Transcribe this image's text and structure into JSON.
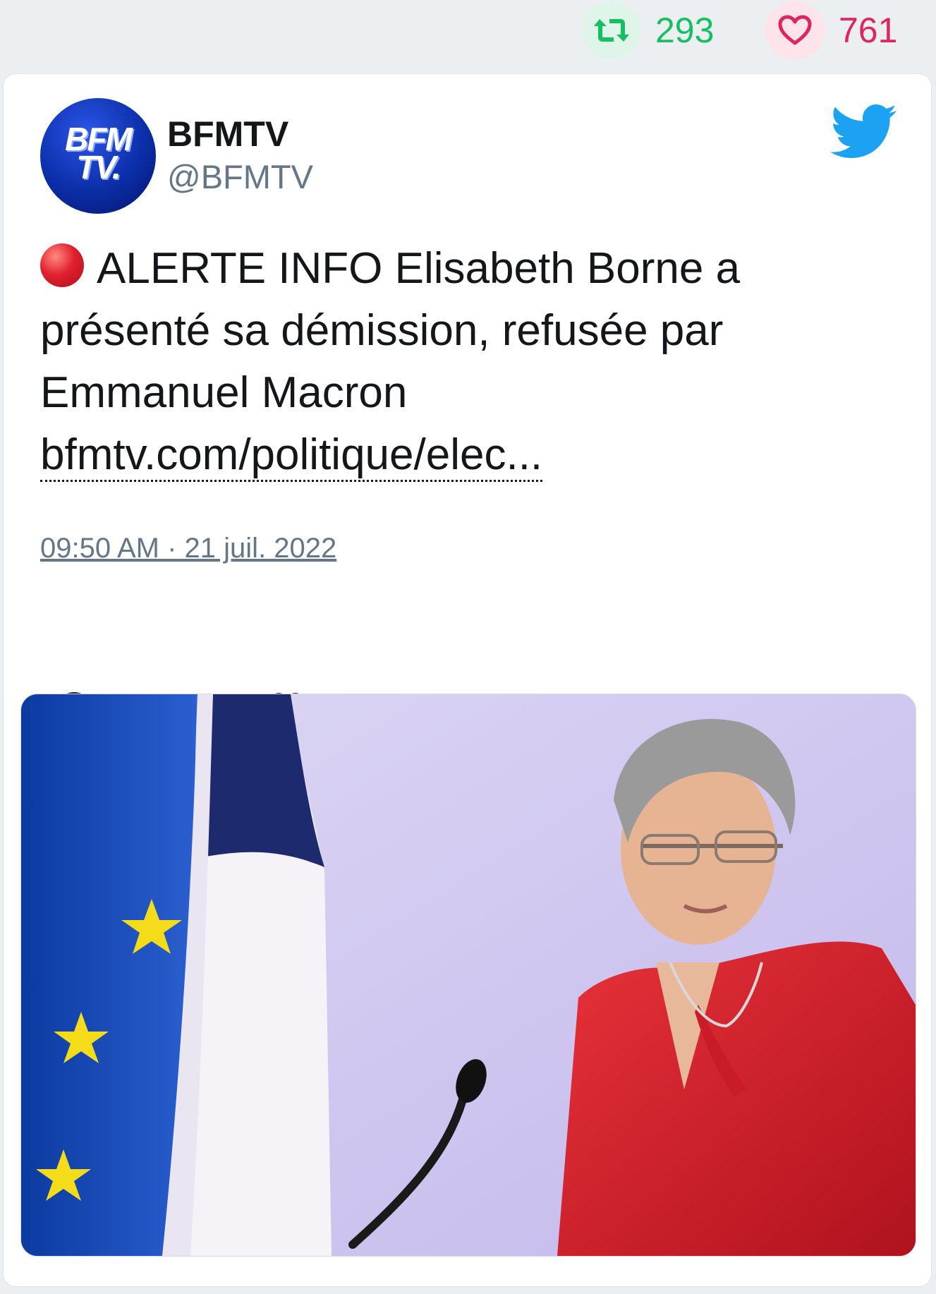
{
  "stats": {
    "retweets": "293",
    "likes": "761",
    "retweet_icon": "retweet-icon",
    "like_icon": "heart-icon",
    "retweet_color": "#17bf63",
    "like_color": "#e0245e"
  },
  "tweet": {
    "author_name": "BFMTV",
    "author_handle": "@BFMTV",
    "avatar_logo_line1": "BFM",
    "avatar_logo_line2": "TV.",
    "text_main": "ALERTE INFO Elisabeth Borne a présenté sa démission, refusée par Emmanuel Macron",
    "link_text": "bfmtv.com/politique/elec...",
    "timestamp": "09:50 AM · 21 juil. 2022",
    "emoji": "red-circle",
    "brand_icon": "twitter-bird-icon",
    "brand_color": "#1da1f2"
  },
  "actions": [
    "reply-icon",
    "retweet-icon",
    "heart-icon"
  ],
  "media": {
    "description_icon": "photo"
  }
}
